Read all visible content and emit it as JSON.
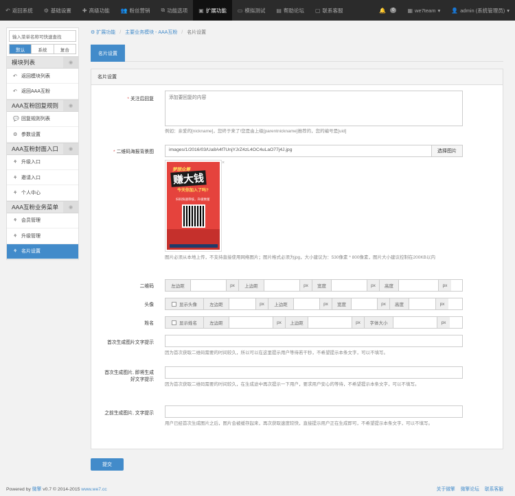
{
  "topnav": {
    "items": [
      {
        "icon": "reply-icon",
        "glyph": "↶",
        "label": "返回系统"
      },
      {
        "icon": "gear-icon",
        "glyph": "⚙",
        "label": "基础设置"
      },
      {
        "icon": "share-icon",
        "glyph": "✚",
        "label": "高级功能"
      },
      {
        "icon": "users-icon",
        "glyph": "👥",
        "label": "粉丝营销"
      },
      {
        "icon": "sliders-icon",
        "glyph": "⧉",
        "label": "功能选项"
      },
      {
        "icon": "cube-icon",
        "glyph": "▣",
        "label": "扩展功能"
      },
      {
        "icon": "monitor-icon",
        "glyph": "▭",
        "label": "模拟测试"
      },
      {
        "icon": "book-icon",
        "glyph": "▤",
        "label": "帮助论坛"
      },
      {
        "icon": "chat-icon",
        "glyph": "▢",
        "label": "联系客服"
      }
    ],
    "active_index": 5,
    "notify_count": "0",
    "account": "we7team",
    "user": "admin (系统管理员)"
  },
  "sidebar": {
    "search_placeholder": "输入菜单名称可快速查找",
    "tabs": [
      "默认",
      "系统",
      "复合"
    ],
    "sections": [
      {
        "title": "模块列表",
        "items": [
          {
            "icon": "undo-icon",
            "glyph": "↶",
            "label": "返回模块列表"
          },
          {
            "icon": "undo-icon",
            "glyph": "↶",
            "label": "返回AAA互粉"
          }
        ]
      },
      {
        "title": "AAA互粉回复规则",
        "items": [
          {
            "icon": "comments-icon",
            "glyph": "💬",
            "label": "回复规则列表"
          },
          {
            "icon": "gear-icon",
            "glyph": "⚙",
            "label": "参数设置"
          }
        ]
      },
      {
        "title": "AAA互粉封面入口",
        "items": [
          {
            "icon": "sitemap-icon",
            "glyph": "⚘",
            "label": "升级入口"
          },
          {
            "icon": "sitemap-icon",
            "glyph": "⚘",
            "label": "邀请入口"
          },
          {
            "icon": "sitemap-icon",
            "glyph": "⚘",
            "label": "个人中心"
          }
        ]
      },
      {
        "title": "AAA互粉业务菜单",
        "items": [
          {
            "icon": "sitemap-icon",
            "glyph": "⚘",
            "label": "会员管理"
          },
          {
            "icon": "sitemap-icon",
            "glyph": "⚘",
            "label": "升级管理"
          },
          {
            "icon": "sitemap-icon",
            "glyph": "⚘",
            "label": "名片设置"
          }
        ]
      }
    ]
  },
  "breadcrumb": {
    "items": [
      "扩展功能",
      "主要业务模块 - AAA互粉"
    ],
    "current": "名片设置"
  },
  "tab_label": "名片设置",
  "panel_title": "名片设置",
  "form": {
    "follow_reply": {
      "label": "关注后回复",
      "placeholder": "添加要回复的内容",
      "help": "例如：亲爱的[nickname]，您终于来了!您是由上级[parentnickname]推荐的，您的编号是[uid]"
    },
    "qr_bg": {
      "label": "二维码海报背景图",
      "value": "images/1/2016/03/Ua8A4f7UnjYJrZ4zL4OC4uLaO77j4J.jpg",
      "button": "选择图片",
      "help": "图片必须从本地上传，不支持直接使用网络图片；图片格式必须为jpg，大小建议为：530像素 * 800像素，图片大小建议控制在200KB以内"
    },
    "poster": {
      "t1": "梦想众筹",
      "t2": "赚大钱",
      "t3": "今天你加入了吗?",
      "t4": "扫码快速审核，升级致富"
    },
    "qrcode": {
      "label": "二维码",
      "addons": [
        "左边距",
        "px",
        "上边距",
        "px",
        "宽度",
        "px",
        "高度",
        "px"
      ]
    },
    "avatar": {
      "label": "头像",
      "check_label": "显示头像",
      "addons": [
        "左边距",
        "px",
        "上边距",
        "px",
        "宽度",
        "px",
        "高度",
        "px"
      ]
    },
    "name": {
      "label": "姓名",
      "check_label": "显示姓名",
      "addons": [
        "左边距",
        "px",
        "上边距",
        "px",
        "字体大小",
        "px"
      ]
    },
    "first_tip": {
      "label": "首次生成图片文字提示",
      "help": "因为首次获取二维码需要的时间较久，所以可以在这里提示用户等待若干秒，不希望提示本条文字，可以不填写。"
    },
    "first_instant_tip": {
      "label_line1": "首次生成图片, 即将生成",
      "label_line2": "好文字提示",
      "help": "因为首次获取二维码需要的时间较久，在生成途中再次提示一下用户，要求用户安心的等待，不希望提示本条文字，可以不填写。"
    },
    "before_tip": {
      "label": "之前生成图片, 文字提示",
      "help": "用户已经首次生成图片之后，图片会被缓存起来，再次获取速度较快，直接提示用户正在生成即可，不希望提示本条文字，可以不填写。"
    }
  },
  "submit_label": "提交",
  "footer": {
    "powered": "Powered by ",
    "brand": "微擎",
    "version": " v0.7 © 2014-2015 ",
    "site": "www.we7.cc",
    "links": [
      "关于微擎",
      "微擎论坛",
      "联系客服"
    ]
  }
}
